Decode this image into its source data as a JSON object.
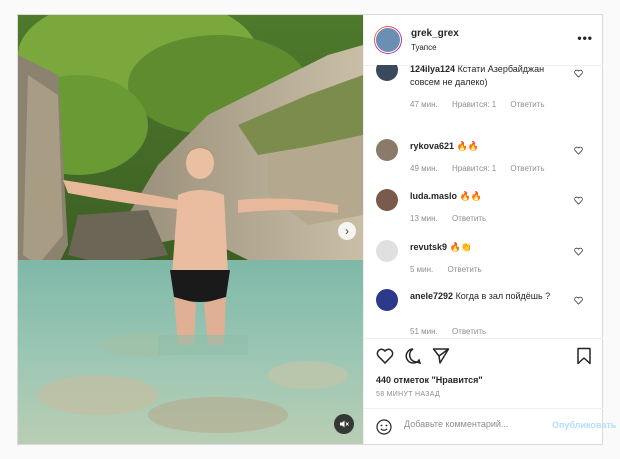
{
  "post": {
    "username": "grek_grex",
    "location": "Туапсе",
    "more_label": "•••"
  },
  "comments": [
    {
      "user": "124ilya124",
      "text": "Кстати Азербайджан совсем не далеко)",
      "time": "47 мин.",
      "likes": "Нравится: 1",
      "reply": "Ответить",
      "avatar_color": "#3a4a5c"
    },
    {
      "user": "rykova621",
      "text": "🔥🔥",
      "time": "49 мин.",
      "likes": "Нравится: 1",
      "reply": "Ответить",
      "avatar_color": "#8a7a6a"
    },
    {
      "user": "luda.maslo",
      "text": "🔥🔥",
      "time": "13 мин.",
      "likes": "",
      "reply": "Ответить",
      "avatar_color": "#7a5a4a"
    },
    {
      "user": "revutsk9",
      "text": "🔥👏",
      "time": "5 мин.",
      "likes": "",
      "reply": "Ответить",
      "avatar_color": "#e0e0e0"
    },
    {
      "user": "anele7292",
      "text": "Когда в зал пойдёшь ?",
      "time": "51 мин.",
      "likes": "",
      "reply": "Ответить",
      "avatar_color": "#2d3a8c"
    }
  ],
  "likes_text": "440 отметок \"Нравится\"",
  "time_ago": "58 МИНУТ НАЗАД",
  "add_comment": {
    "placeholder": "Добавьте комментарий...",
    "post_label": "Опубликовать"
  },
  "icons": {
    "like": "heart-icon",
    "comment": "comment-icon",
    "share": "share-icon",
    "save": "bookmark-icon",
    "emoji": "emoji-icon",
    "next": "chevron-right-icon",
    "sound": "mute-icon"
  }
}
